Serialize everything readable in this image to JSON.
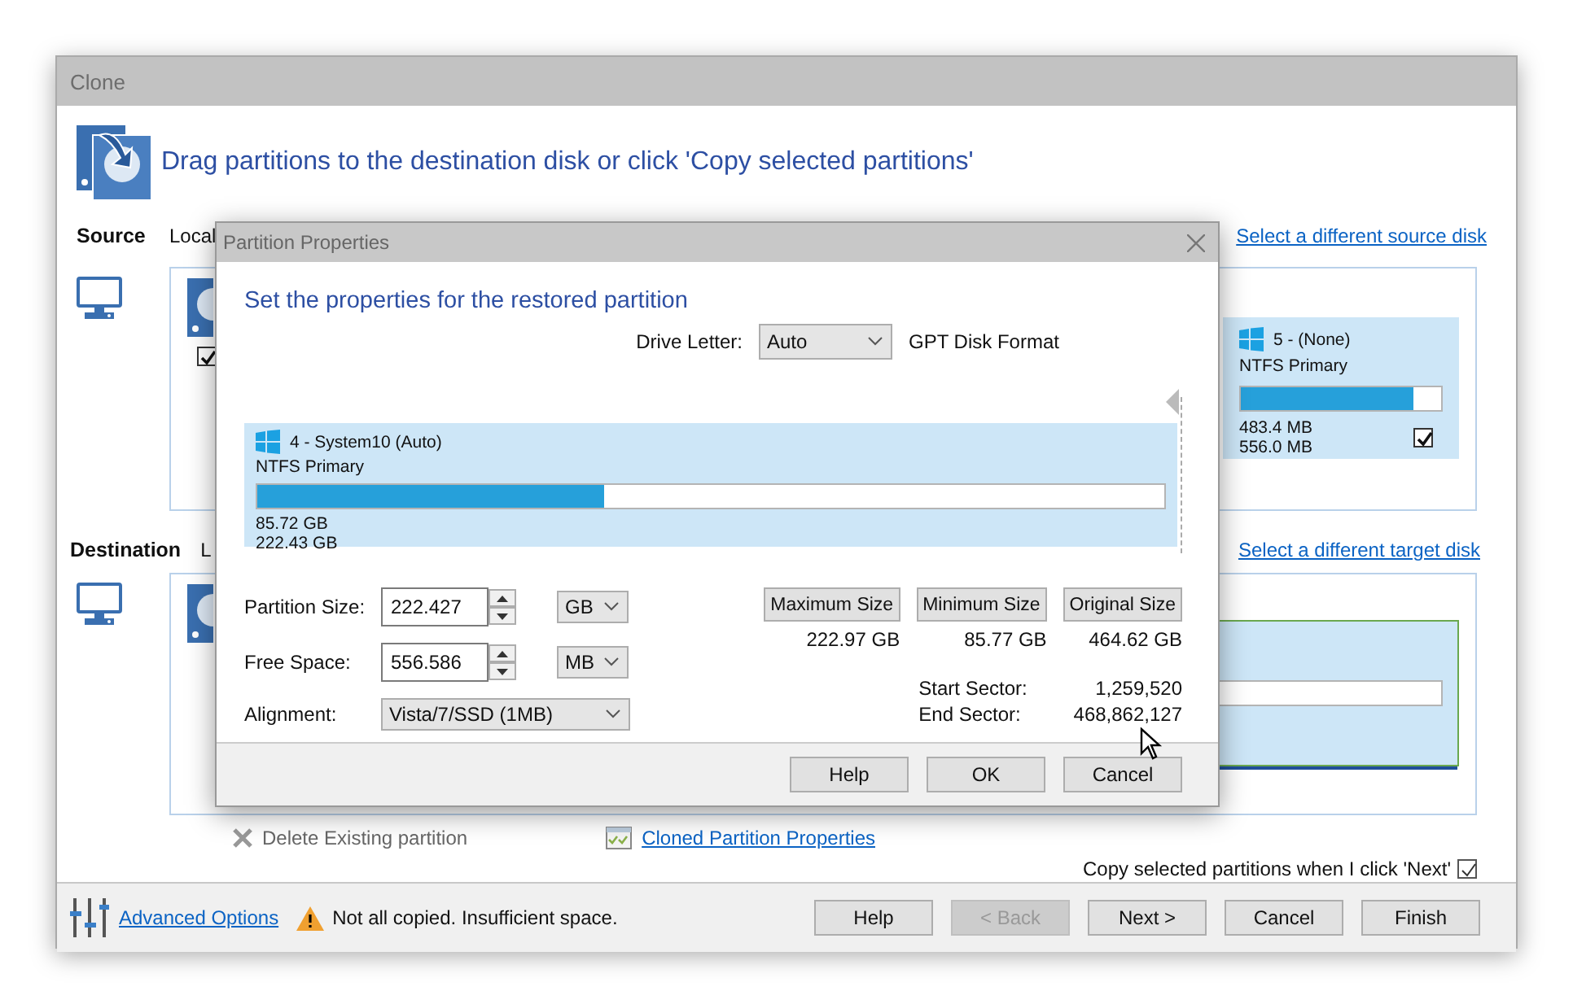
{
  "clone_window": {
    "title": "Clone",
    "header": "Drag partitions to the destination disk or click 'Copy selected partitions'",
    "source": {
      "label": "Source",
      "disk_label": "Local",
      "link": "Select a different source disk",
      "disk_checked": true,
      "partition": {
        "title": "5 -  (None)",
        "type": "NTFS Primary",
        "level": 0.86,
        "used": "483.4 MB",
        "total": "556.0 MB",
        "checked": true
      }
    },
    "destination": {
      "label": "Destination",
      "disk_label": "L",
      "link": "Select a different target disk"
    },
    "actions": [
      {
        "label": "Delete Existing partition",
        "kind": "delete",
        "disabled": true
      },
      {
        "label": "Cloned Partition Properties",
        "kind": "properties",
        "disabled": false
      }
    ],
    "copy_option": {
      "label": "Copy selected partitions when I click 'Next'",
      "checked": true
    },
    "footer": {
      "advanced_options": "Advanced Options",
      "warning": "Not all copied. Insufficient space.",
      "buttons": [
        {
          "label": "Help",
          "disabled": false
        },
        {
          "label": "< Back",
          "disabled": true
        },
        {
          "label": "Next >",
          "disabled": false
        },
        {
          "label": "Cancel",
          "disabled": false
        },
        {
          "label": "Finish",
          "disabled": false
        }
      ]
    }
  },
  "dialog": {
    "title": "Partition Properties",
    "heading": "Set the properties for the restored partition",
    "drive_letter": {
      "label": "Drive Letter:",
      "value": "Auto"
    },
    "disk_format": "GPT Disk Format",
    "partition": {
      "title": "4 - System10 (Auto)",
      "type": "NTFS Primary",
      "level": 0.383,
      "used": "85.72 GB",
      "total": "222.43 GB"
    },
    "fields": [
      {
        "label": "Partition Size:",
        "kind": "spin",
        "value": "222.427",
        "unit": "GB"
      },
      {
        "label": "Free Space:",
        "kind": "spin",
        "value": "556.586",
        "unit": "MB"
      },
      {
        "label": "Alignment:",
        "kind": "select",
        "value": "Vista/7/SSD (1MB)"
      }
    ],
    "size_buttons": [
      {
        "label": "Maximum Size",
        "value": "222.97 GB"
      },
      {
        "label": "Minimum Size",
        "value": "85.77 GB"
      },
      {
        "label": "Original Size",
        "value": "464.62 GB"
      }
    ],
    "sectors": [
      {
        "label": "Start Sector:",
        "value": "1,259,520"
      },
      {
        "label": "End Sector:",
        "value": "468,862,127"
      }
    ],
    "buttons": [
      "Help",
      "OK",
      "Cancel"
    ]
  }
}
